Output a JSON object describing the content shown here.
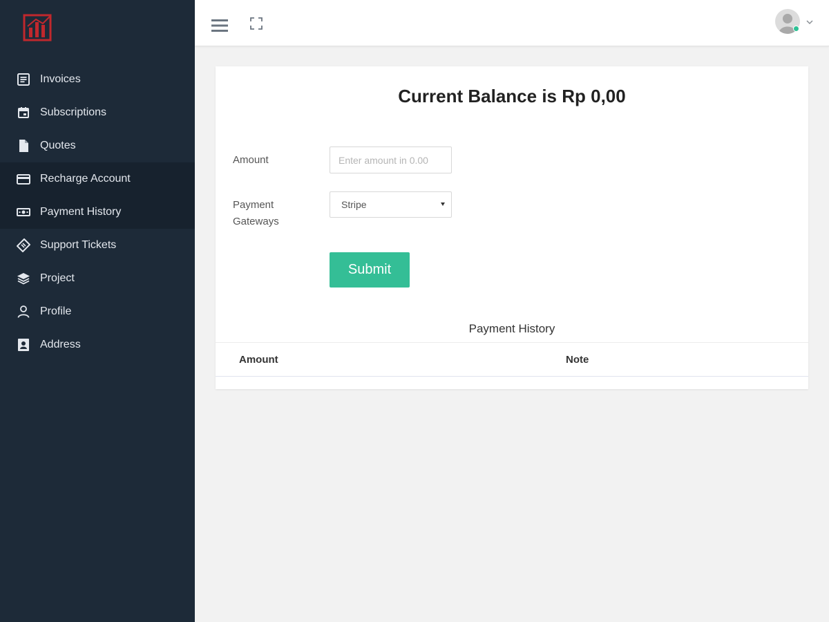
{
  "sidebar": {
    "logo_icon": "brand-chart-logo",
    "items": [
      {
        "label": "Invoices",
        "icon": "invoice-icon",
        "active": false
      },
      {
        "label": "Subscriptions",
        "icon": "calendar-icon",
        "active": false
      },
      {
        "label": "Quotes",
        "icon": "document-icon",
        "active": false
      },
      {
        "label": "Recharge Account",
        "icon": "credit-card-icon",
        "active": true
      },
      {
        "label": "Payment History",
        "icon": "money-icon",
        "active": true
      },
      {
        "label": "Support Tickets",
        "icon": "ticket-icon",
        "active": false
      },
      {
        "label": "Project",
        "icon": "layers-icon",
        "active": false
      },
      {
        "label": "Profile",
        "icon": "user-icon",
        "active": false
      },
      {
        "label": "Address",
        "icon": "address-book-icon",
        "active": false
      }
    ]
  },
  "topbar": {
    "menu_icon": "hamburger-icon",
    "fullscreen_icon": "expand-icon",
    "user_status": "online"
  },
  "main": {
    "balance_text": "Current Balance is Rp 0,00",
    "form": {
      "amount_label": "Amount",
      "amount_value": "",
      "amount_placeholder": "Enter amount in 0.00",
      "gateway_label_line1": "Payment",
      "gateway_label_line2": "Gateways",
      "gateway_selected": "Stripe",
      "submit_label": "Submit"
    },
    "history": {
      "title": "Payment History",
      "columns": [
        "Amount",
        "Note"
      ],
      "rows": []
    }
  },
  "colors": {
    "sidebar_bg": "#1d2a38",
    "sidebar_active": "#17222e",
    "accent": "#34be96",
    "logo": "#c0282d"
  }
}
